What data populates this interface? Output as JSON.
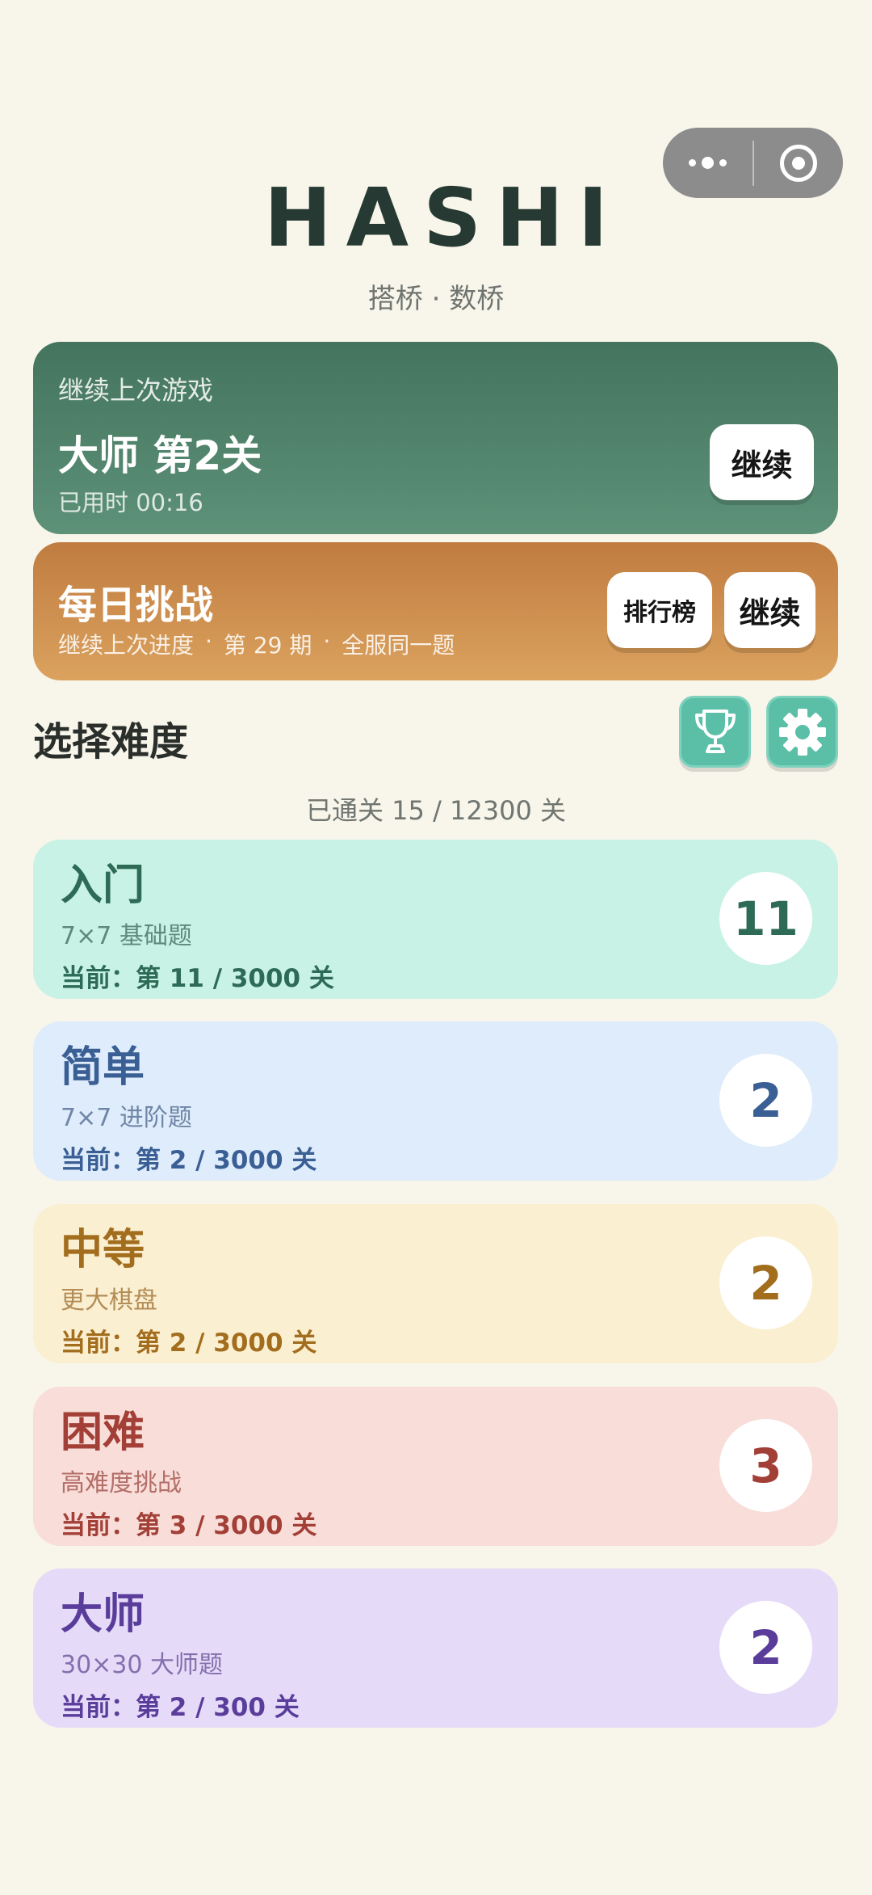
{
  "header": {
    "title": "HASHI",
    "subtitle": "搭桥 · 数桥"
  },
  "continue_card": {
    "label": "继续上次游戏",
    "level": "大师 第2关",
    "time": "已用时 00:16",
    "button": "继续"
  },
  "daily_card": {
    "title": "每日挑战",
    "info_progress": "继续上次进度",
    "info_issue": "第 29 期",
    "info_scope": "全服同一题",
    "separator": "·",
    "leaderboard_button": "排行榜",
    "continue_button": "继续"
  },
  "difficulty_section": {
    "title": "选择难度",
    "total_progress": "已通关 15 / 12300 关",
    "icons": [
      "trophy-icon",
      "gear-icon"
    ]
  },
  "difficulties": [
    {
      "name": "入门",
      "desc": "7×7 基础题",
      "current": "当前：第 11 / 3000 关",
      "badge": "11",
      "color": "#2e6b57"
    },
    {
      "name": "简单",
      "desc": "7×7 进阶题",
      "current": "当前：第 2 / 3000 关",
      "badge": "2",
      "color": "#3a5f94"
    },
    {
      "name": "中等",
      "desc": "更大棋盘",
      "current": "当前：第 2 / 3000 关",
      "badge": "2",
      "color": "#a26d1d"
    },
    {
      "name": "困难",
      "desc": "高难度挑战",
      "current": "当前：第 3 / 3000 关",
      "badge": "3",
      "color": "#a23f36"
    },
    {
      "name": "大师",
      "desc": "30×30 大师题",
      "current": "当前：第 2 / 300 关",
      "badge": "2",
      "color": "#5a3c9b"
    }
  ]
}
